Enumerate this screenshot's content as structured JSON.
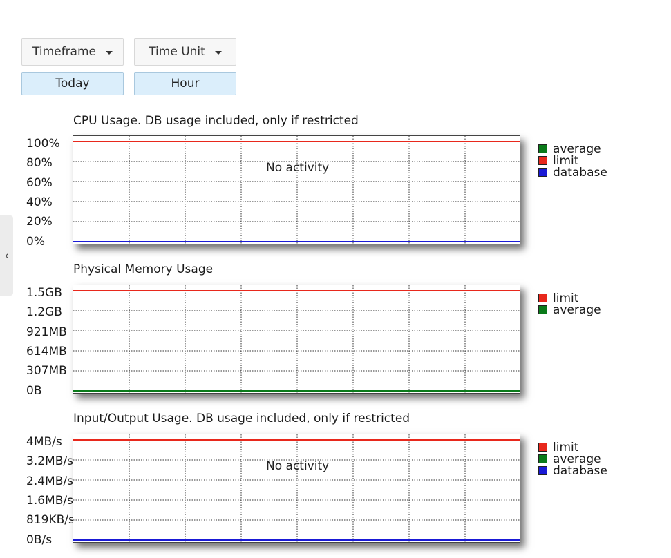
{
  "controls": {
    "timeframe_label": "Timeframe",
    "timeunit_label": "Time Unit",
    "timeframe_value": "Today",
    "timeunit_value": "Hour"
  },
  "sidebar": {
    "collapse_icon": "chevron-left-icon",
    "collapse_glyph": "‹"
  },
  "colors": {
    "limit": "#e8281c",
    "average": "#0a7a1a",
    "database": "#1a1ad6",
    "grid": "#444444"
  },
  "charts": [
    {
      "title": "CPU Usage. DB usage included, only if restricted",
      "no_activity": "No activity",
      "yticks": [
        "100%",
        "80%",
        "60%",
        "40%",
        "20%",
        "0%"
      ],
      "legend": [
        {
          "name": "average",
          "color": "#0a7a1a"
        },
        {
          "name": "limit",
          "color": "#e8281c"
        },
        {
          "name": "database",
          "color": "#1a1ad6"
        }
      ]
    },
    {
      "title": "Physical Memory Usage",
      "no_activity": "",
      "yticks": [
        "1.5GB",
        "1.2GB",
        "921MB",
        "614MB",
        "307MB",
        "0B"
      ],
      "legend": [
        {
          "name": "limit",
          "color": "#e8281c"
        },
        {
          "name": "average",
          "color": "#0a7a1a"
        }
      ]
    },
    {
      "title": "Input/Output Usage. DB usage included, only if restricted",
      "no_activity": "No activity",
      "yticks": [
        "4MB/s",
        "3.2MB/s",
        "2.4MB/s",
        "1.6MB/s",
        "819KB/s",
        "0B/s"
      ],
      "legend": [
        {
          "name": "limit",
          "color": "#e8281c"
        },
        {
          "name": "average",
          "color": "#0a7a1a"
        },
        {
          "name": "database",
          "color": "#1a1ad6"
        }
      ]
    }
  ],
  "chart_data": [
    {
      "type": "line",
      "title": "CPU Usage. DB usage included, only if restricted",
      "ylim": [
        "0%",
        "100%"
      ],
      "grid": true,
      "legend_position": "right",
      "series": [
        {
          "name": "limit",
          "values": [
            100
          ]
        },
        {
          "name": "average",
          "values": [
            0
          ]
        },
        {
          "name": "database",
          "values": [
            0
          ]
        }
      ]
    },
    {
      "type": "line",
      "title": "Physical Memory Usage",
      "ylim": [
        "0B",
        "1.5GB"
      ],
      "grid": true,
      "legend_position": "right",
      "series": [
        {
          "name": "limit",
          "values": [
            "1.5GB"
          ]
        },
        {
          "name": "average",
          "values": [
            "0B"
          ]
        }
      ]
    },
    {
      "type": "line",
      "title": "Input/Output Usage. DB usage included, only if restricted",
      "ylim": [
        "0B/s",
        "4MB/s"
      ],
      "grid": true,
      "legend_position": "right",
      "series": [
        {
          "name": "limit",
          "values": [
            "4MB/s"
          ]
        },
        {
          "name": "average",
          "values": [
            "0B/s"
          ]
        },
        {
          "name": "database",
          "values": [
            "0B/s"
          ]
        }
      ]
    }
  ]
}
